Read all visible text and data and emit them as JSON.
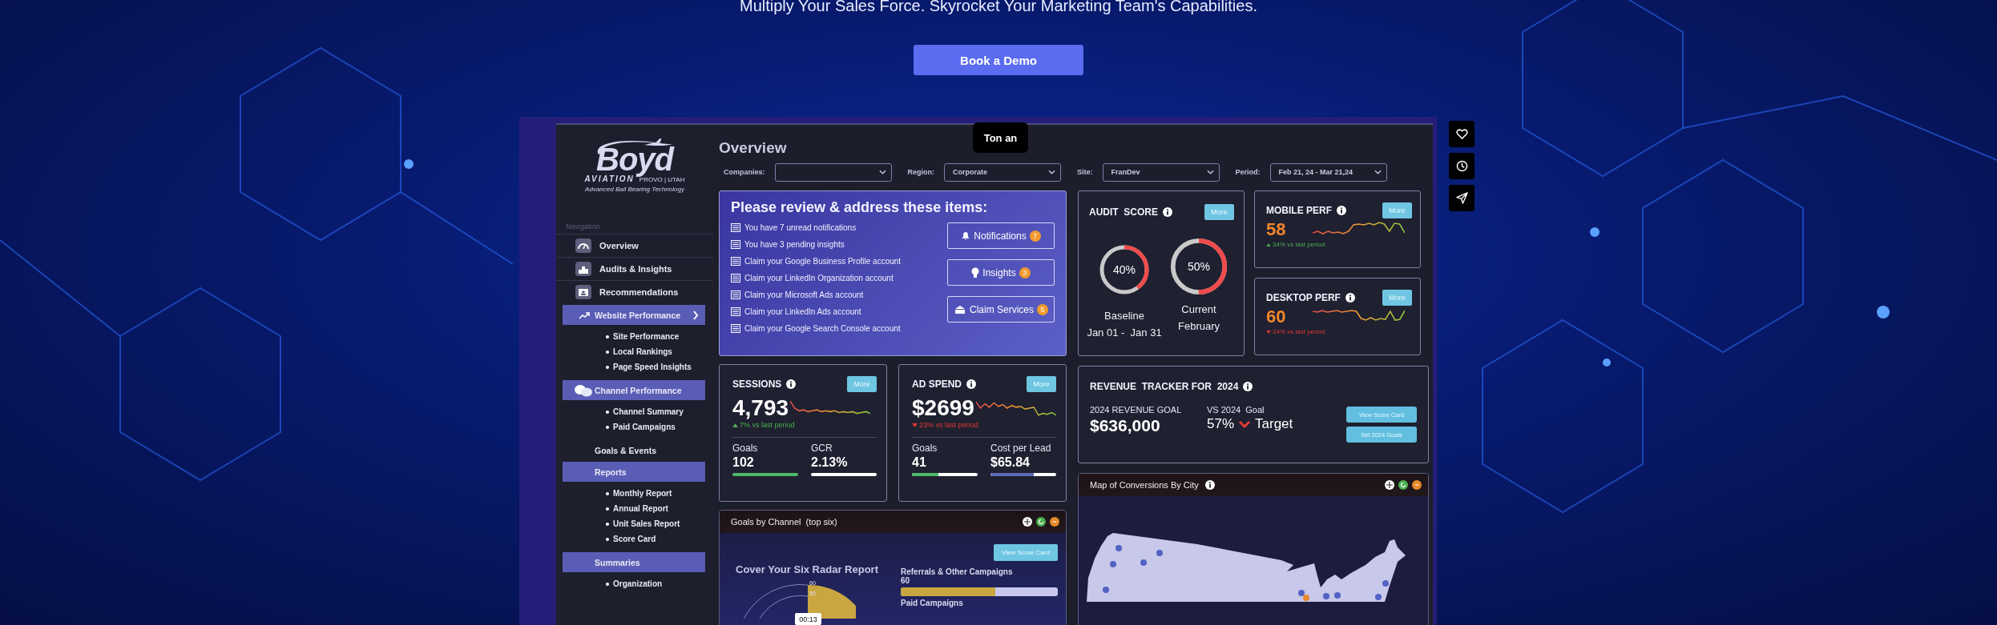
{
  "hero": {
    "headline": "Multiply Your Sales Force. Skyrocket Your Marketing Team's Capabilities.",
    "cta": "Book a Demo"
  },
  "tooltip": "Ton an",
  "video_timer": "00:13",
  "sidebar": {
    "logo": {
      "name": "Boyd",
      "subtitle": "AVIATION",
      "location": "PROVO | UTAH",
      "tagline": "Advanced Ball Bearing Technology"
    },
    "section_label": "Navigation",
    "items": [
      {
        "kind": "link",
        "label": "Overview"
      },
      {
        "kind": "link",
        "label": "Audits & Insights"
      },
      {
        "kind": "link",
        "label": "Recommendations"
      },
      {
        "kind": "group",
        "label": "Website Performance",
        "expanded": true,
        "children": [
          {
            "label": "Site Performance"
          },
          {
            "label": "Local Rankings"
          },
          {
            "label": "Page Speed Insights"
          }
        ]
      },
      {
        "kind": "group",
        "label": "Channel  Performance",
        "expanded": true,
        "children": [
          {
            "label": "Channel  Summary"
          },
          {
            "label": "Paid Campaigns"
          }
        ]
      },
      {
        "kind": "group",
        "label": "Goals & Events",
        "expanded": false
      },
      {
        "kind": "group",
        "label": "Reports",
        "expanded": true,
        "children": [
          {
            "label": "Monthly Report"
          },
          {
            "label": "Annual  Report"
          },
          {
            "label": "Unit Sales Report"
          },
          {
            "label": "Score Card"
          }
        ]
      },
      {
        "kind": "group",
        "label": "Summaries",
        "expanded": true,
        "children": [
          {
            "label": "Organization"
          }
        ]
      }
    ]
  },
  "overview": {
    "title": "Overview",
    "filters": [
      {
        "label": "Companies:"
      },
      {
        "label": "Region:",
        "value": "Corporate"
      },
      {
        "label": "Site:",
        "value": "FranDev"
      },
      {
        "label": "Period:",
        "value": "Feb 21, 24 - Mar 21,24"
      }
    ]
  },
  "review": {
    "title": "Please review & address these items:",
    "items": [
      "You have 7 unread  notifications",
      "You have 3 pending insights",
      "Claim your Google Business  Profile account",
      "Claim your LinkedIn Organization account",
      "Claim your  Microsoft Ads account",
      "Claim your LinkedIn Ads account",
      "Claim your  Google Search Console account"
    ],
    "actions": [
      {
        "label": "Notifications",
        "count": "7"
      },
      {
        "label": "Insights",
        "count": "3"
      },
      {
        "label": "Claim Services",
        "count": "5"
      }
    ]
  },
  "audit_score": {
    "title": "AUDIT  SCORE",
    "more": "More",
    "gauges": [
      {
        "percent": "40%",
        "level": 0.4,
        "label": "Baseline",
        "period": "Jan 01 -  Jan 31"
      },
      {
        "percent": "50%",
        "level": 0.5,
        "label": "Current",
        "period": "February"
      }
    ]
  },
  "perf": [
    {
      "title": "MOBILE PERF",
      "more": "More",
      "value": "58",
      "change": "34% vs last  period",
      "positive": true
    },
    {
      "title": "DESKTOP PERF",
      "more": "More",
      "value": "60",
      "change": "24% vs last period",
      "positive": false
    }
  ],
  "kpis": [
    {
      "title": "SESSIONS",
      "more": "More",
      "value": "4,793",
      "change": "7% vs last  period",
      "positive": true,
      "metrics": [
        {
          "label": "Goals",
          "value": "102",
          "level": 1,
          "color": "#4cb86a"
        },
        {
          "label": "GCR",
          "value": "2.13%",
          "level": 0
        }
      ]
    },
    {
      "title": "AD SPEND",
      "more": "More",
      "value": "$2699",
      "change": "23% vs last period",
      "positive": false,
      "metrics": [
        {
          "label": "Goals",
          "value": "41",
          "level": 0.4,
          "color": "#4cb86a"
        },
        {
          "label": "Cost per Lead",
          "value": "$65.84",
          "level": 0.66,
          "color": "#5b6bb8"
        }
      ]
    }
  ],
  "revenue": {
    "title": "REVENUE  TRACKER FOR  2024",
    "goal_label": "2024 REVENUE GOAL",
    "goal": "$636,000",
    "vs_label": "VS 2024  Goal",
    "vs_percent": "57%",
    "positive": false,
    "vs_target": "Target",
    "buttons": [
      "View Score Card",
      "Set 2024 Goals"
    ]
  },
  "goals_by_channel": {
    "title": "Goals by Channel  (top six)",
    "button": "View Score Card",
    "radar_title": "Cover Your Six Radar Report",
    "radar_ticks": [
      "60",
      "50"
    ],
    "channels": [
      {
        "name": "Referrals & Other Campaigns",
        "value": "60",
        "level": 0.6
      },
      {
        "name": "Paid Campaigns"
      }
    ]
  },
  "map": {
    "title": "Map of Conversions By City"
  }
}
